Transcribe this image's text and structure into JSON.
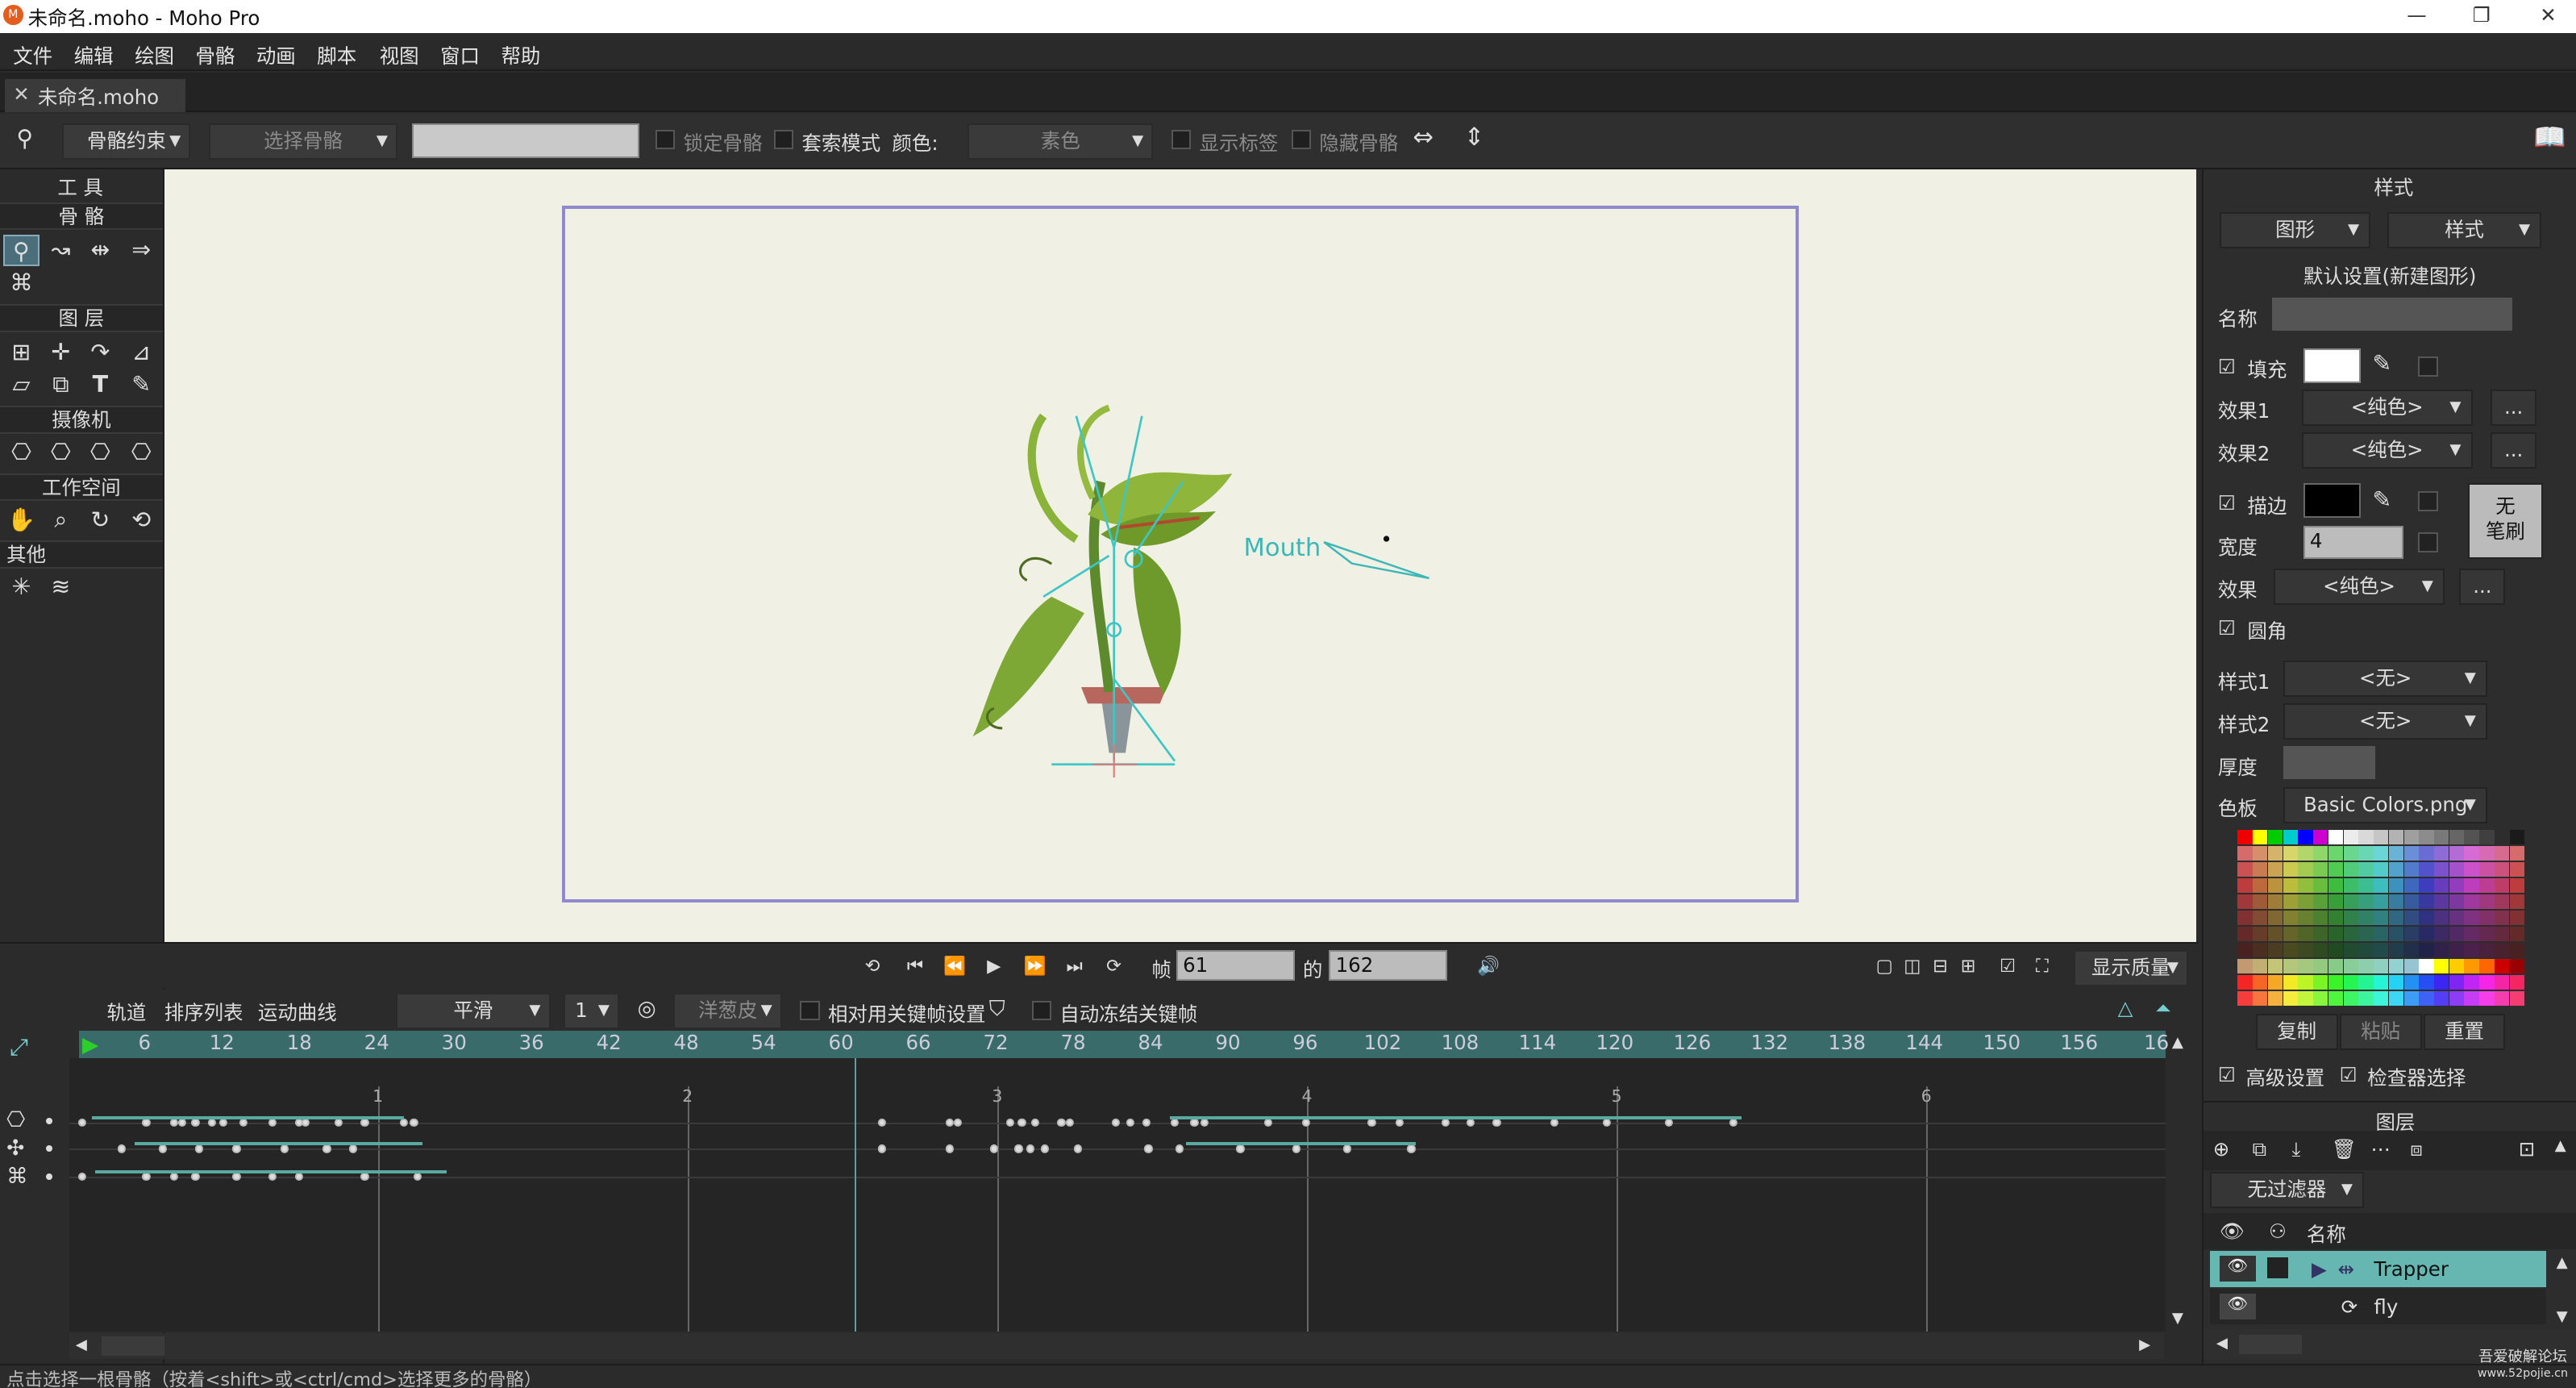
{
  "window": {
    "title": "未命名.moho - Moho Pro",
    "app_icon": "moho-icon"
  },
  "menu": [
    "文件",
    "编辑",
    "绘图",
    "骨骼",
    "动画",
    "脚本",
    "视图",
    "窗口",
    "帮助"
  ],
  "doc_tab": "未命名.moho",
  "tool_options": {
    "bone_constraint": "骨骼约束",
    "select_bone": "选择骨骼",
    "lock_bone": "锁定骨骼",
    "lasso_mode": "套索模式",
    "color_label": "颜色:",
    "color_value": "素色",
    "show_labels": "显示标签",
    "hide_bones": "隐藏骨骼"
  },
  "tools": {
    "header": "工 具",
    "sections": {
      "bone": "骨 骼",
      "layer": "图 层",
      "camera": "摄像机",
      "workspace": "工作空间",
      "other": "其他"
    }
  },
  "canvas": {
    "label": "Mouth"
  },
  "playback": {
    "frame_label": "帧",
    "frame_value": "61",
    "of_label": "的",
    "total_frames": "162",
    "quality": "显示质量"
  },
  "timeline": {
    "tabs": [
      "轨道",
      "排序列表",
      "运动曲线"
    ],
    "interpolation": "平滑",
    "step": "1",
    "onion": "洋葱皮",
    "relative_keys": "相对用关键帧设置",
    "auto_freeze": "自动冻结关键帧",
    "ruler": [
      "6",
      "12",
      "18",
      "24",
      "30",
      "36",
      "42",
      "48",
      "54",
      "60",
      "66",
      "72",
      "78",
      "84",
      "90",
      "96",
      "102",
      "108",
      "114",
      "120",
      "126",
      "132",
      "138",
      "144",
      "150",
      "156",
      "16"
    ],
    "sections": [
      "1",
      "2",
      "3",
      "4",
      "5",
      "6"
    ]
  },
  "style_panel": {
    "title": "样式",
    "tab_shape": "图形",
    "tab_style": "样式",
    "defaults": "默认设置(新建图形)",
    "name_label": "名称",
    "fill_label": "填充",
    "effect1_label": "效果1",
    "effect2_label": "效果2",
    "pure_color": "<纯色>",
    "stroke_label": "描边",
    "width_label": "宽度",
    "width_value": "4",
    "effect_label": "效果",
    "no_brush": "无\n笔刷",
    "round_cap": "圆角",
    "style1_label": "样式1",
    "style2_label": "样式2",
    "none_value": "<无>",
    "thickness_label": "厚度",
    "palette_label": "色板",
    "palette_value": "Basic Colors.png",
    "copy": "复制",
    "paste": "粘贴",
    "reset": "重置",
    "advanced": "高级设置",
    "checker": "检查器选择",
    "more": "..."
  },
  "layers_panel": {
    "title": "图层",
    "filter": "无过滤器",
    "name_header": "名称",
    "layers": [
      {
        "name": "Trapper",
        "selected": true
      },
      {
        "name": "fly",
        "selected": false
      }
    ]
  },
  "status": "点击选择一根骨骼（按着<shift>或<ctrl/cmd>选择更多的骨骼）",
  "watermark": [
    "吾爱破解论坛",
    "www.52pojie.cn"
  ],
  "colors": {
    "accent": "#3a6b6b",
    "selected_layer": "#66b7b1",
    "canvas_bg": "#f1f0e4",
    "frame_border": "#8f8acb"
  }
}
